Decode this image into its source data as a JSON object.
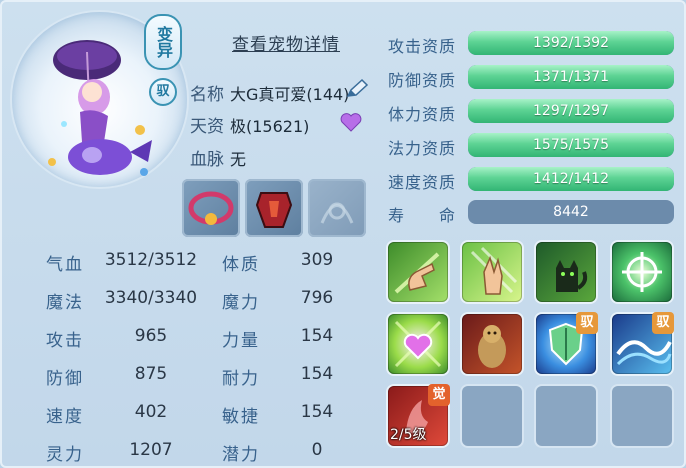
{
  "header": {
    "mutation_badge": "变异",
    "tamed_badge": "驭",
    "details_link": "查看宠物详情"
  },
  "info": {
    "name_label": "名称",
    "name_value": "大G真可爱(144)",
    "talent_label": "天资",
    "talent_value": "极(15621)",
    "bloodline_label": "血脉",
    "bloodline_value": "无"
  },
  "stats": [
    {
      "label": "气血",
      "value": "3512/3512"
    },
    {
      "label": "魔法",
      "value": "3340/3340"
    },
    {
      "label": "攻击",
      "value": "965"
    },
    {
      "label": "防御",
      "value": "875"
    },
    {
      "label": "速度",
      "value": "402"
    },
    {
      "label": "灵力",
      "value": "1207"
    }
  ],
  "attributes": [
    {
      "label": "体质",
      "value": "309"
    },
    {
      "label": "魔力",
      "value": "796"
    },
    {
      "label": "力量",
      "value": "154"
    },
    {
      "label": "耐力",
      "value": "154"
    },
    {
      "label": "敏捷",
      "value": "154"
    },
    {
      "label": "潜力",
      "value": "0"
    }
  ],
  "aptitudes": [
    {
      "label": "攻击资质",
      "value": "1392/1392",
      "fill": 1.0
    },
    {
      "label": "防御资质",
      "value": "1371/1371",
      "fill": 1.0
    },
    {
      "label": "体力资质",
      "value": "1297/1297",
      "fill": 1.0
    },
    {
      "label": "法力资质",
      "value": "1575/1575",
      "fill": 1.0
    },
    {
      "label": "速度资质",
      "value": "1412/1412",
      "fill": 1.0
    }
  ],
  "life": {
    "label": "寿　　命",
    "value": "8442"
  },
  "skills": {
    "tag_yu": "驭",
    "tag_jue": "觉",
    "awaken_level": "2/5级"
  },
  "colors": {
    "bar_fill": "#4fcb8c",
    "bar_track": "#6c8bab",
    "label_blue": "#38628c"
  }
}
